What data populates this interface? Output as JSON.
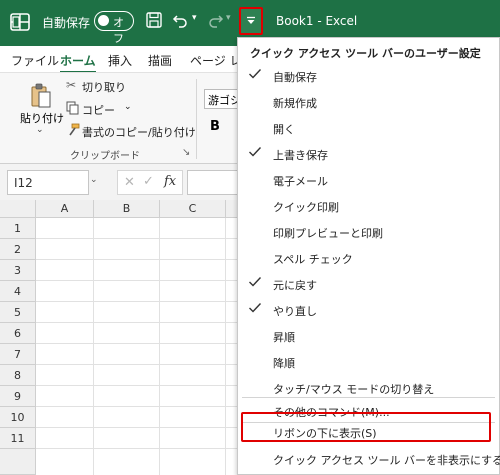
{
  "titlebar": {
    "autosave_label": "自動保存",
    "autosave_state": "オフ",
    "doc_title": "Book1  -  Excel",
    "accent": "#1e7145"
  },
  "ribbon_tabs": [
    "ファイル",
    "ホーム",
    "挿入",
    "描画",
    "ページ レ"
  ],
  "ribbon": {
    "paste": "貼り付け",
    "cut": "切り取り",
    "copy": "コピー",
    "format_painter": "書式のコピー/貼り付け",
    "clipboard_group": "クリップボード",
    "font_name": "游ゴシッ",
    "bold": "B"
  },
  "formula_bar": {
    "name_box": "I12",
    "fx": "fx"
  },
  "grid": {
    "columns": [
      "A",
      "B",
      "C"
    ],
    "rows": [
      "1",
      "2",
      "3",
      "4",
      "5",
      "6",
      "7",
      "8",
      "9",
      "10",
      "11"
    ]
  },
  "menu": {
    "title": "クイック アクセス ツール バーのユーザー設定",
    "items": [
      {
        "label": "自動保存",
        "checked": true
      },
      {
        "label": "新規作成",
        "checked": false
      },
      {
        "label": "開く",
        "checked": false
      },
      {
        "label": "上書き保存",
        "checked": true
      },
      {
        "label": "電子メール",
        "checked": false
      },
      {
        "label": "クイック印刷",
        "checked": false
      },
      {
        "label": "印刷プレビューと印刷",
        "checked": false
      },
      {
        "label": "スペル チェック",
        "checked": false
      },
      {
        "label": "元に戻す",
        "checked": true
      },
      {
        "label": "やり直し",
        "checked": true
      },
      {
        "label": "昇順",
        "checked": false
      },
      {
        "label": "降順",
        "checked": false
      },
      {
        "label": "タッチ/マウス モードの切り替え",
        "checked": false
      }
    ],
    "more_commands": "その他のコマンド(M)...",
    "show_below_ribbon": "リボンの下に表示(S)",
    "hide_qat": "クイック アクセス ツール バーを非表示にする (H)",
    "highlight_color": "#e00000"
  }
}
